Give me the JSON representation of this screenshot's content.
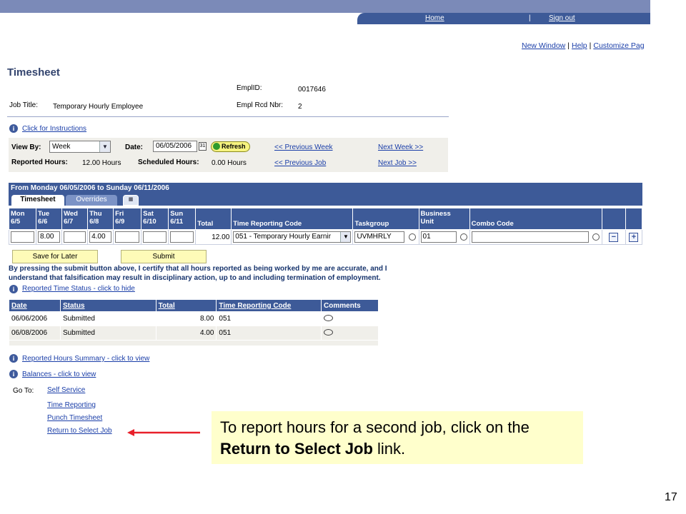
{
  "header": {
    "home_link": "Home",
    "separator": "|",
    "signout_link": "Sign out"
  },
  "top_links": {
    "new_window": "New Window",
    "help": "Help",
    "customize": "Customize Pag",
    "separator": "|"
  },
  "page_title": "Timesheet",
  "employee": {
    "emplid_label": "EmplID:",
    "emplid_value": "0017646",
    "job_title_label": "Job Title:",
    "job_title_value": "Temporary Hourly Employee",
    "empl_rcd_label": "Empl Rcd Nbr:",
    "empl_rcd_value": "2"
  },
  "instructions_link": "Click for Instructions",
  "search": {
    "view_by_label": "View By:",
    "view_by_value": "Week",
    "date_label": "Date:",
    "date_value": "06/05/2006",
    "refresh_label": "Refresh",
    "prev_week": "<< Previous Week",
    "next_week": "Next Week >>",
    "reported_hours_label": "Reported Hours:",
    "reported_hours_value": "12.00 Hours",
    "scheduled_hours_label": "Scheduled Hours:",
    "scheduled_hours_value": "0.00 Hours",
    "prev_job": "<< Previous Job",
    "next_job": "Next Job >>"
  },
  "grid": {
    "period_title": "From Monday 06/05/2006 to Sunday 06/11/2006",
    "tabs": [
      "Timesheet",
      "Overrides"
    ],
    "columns": [
      {
        "day": "Mon",
        "date": "6/5"
      },
      {
        "day": "Tue",
        "date": "6/6"
      },
      {
        "day": "Wed",
        "date": "6/7"
      },
      {
        "day": "Thu",
        "date": "6/8"
      },
      {
        "day": "Fri",
        "date": "6/9"
      },
      {
        "day": "Sat",
        "date": "6/10"
      },
      {
        "day": "Sun",
        "date": "6/11"
      }
    ],
    "total_header": "Total",
    "trc_header": "Time Reporting Code",
    "taskgroup_header": "Taskgroup",
    "bu_header_1": "Business",
    "bu_header_2": "Unit",
    "combo_header": "Combo Code",
    "row": {
      "mon": "",
      "tue": "8.00",
      "wed": "",
      "thu": "4.00",
      "fri": "",
      "sat": "",
      "sun": "",
      "total": "12.00",
      "trc": "051 - Temporary Hourly Earnir",
      "taskgroup": "UVMHRLY",
      "business_unit": "01",
      "combo_code": ""
    }
  },
  "buttons": {
    "save_later": "Save for Later",
    "submit": "Submit"
  },
  "certify_text": "By pressing the submit button above, I certify that all hours reported as being worked by me are accurate, and I understand that falsification may result in disciplinary action, up to and including termination of employment.",
  "reported_status_link": "Reported Time Status - click to hide",
  "status_table": {
    "headers": [
      "Date",
      "Status",
      "Total",
      "Time Reporting Code",
      "Comments"
    ],
    "rows": [
      {
        "date": "06/06/2006",
        "status": "Submitted",
        "total": "8.00",
        "trc": "051"
      },
      {
        "date": "06/08/2006",
        "status": "Submitted",
        "total": "4.00",
        "trc": "051"
      }
    ]
  },
  "summary_link": "Reported Hours Summary - click to view",
  "balances_link": "Balances - click to view",
  "goto": {
    "label": "Go To:",
    "links": [
      "Self Service",
      "Time Reporting",
      "Punch Timesheet",
      "Return to Select Job"
    ]
  },
  "callout": {
    "text_before": "To report hours for a second job, click on the ",
    "bold": "Return to Select Job",
    "text_after": " link."
  },
  "slide_number": "17",
  "colors": {
    "header_blue": "#3d5a98",
    "panel_gray": "#f0efea",
    "callout_yellow": "#ffffcc",
    "arrow_red": "#e8202a"
  }
}
